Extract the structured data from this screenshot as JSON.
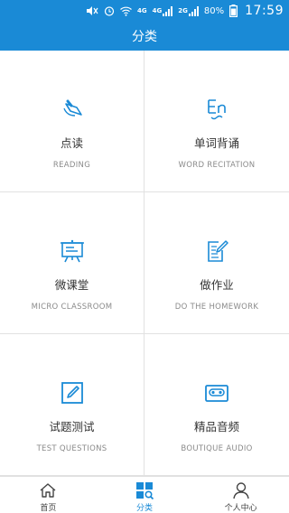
{
  "status_bar": {
    "network_a": "4G",
    "network_b": "4G",
    "network_c": "2G",
    "battery": "80%",
    "time": "17:59"
  },
  "title": "分类",
  "categories": [
    {
      "label": "点读",
      "sublabel": "READING",
      "icon": "reading-pen-icon"
    },
    {
      "label": "单词背诵",
      "sublabel": "WORD RECITATION",
      "icon": "en-word-icon"
    },
    {
      "label": "微课堂",
      "sublabel": "MICRO CLASSROOM",
      "icon": "presentation-board-icon"
    },
    {
      "label": "做作业",
      "sublabel": "DO THE HOMEWORK",
      "icon": "homework-edit-icon"
    },
    {
      "label": "试题测试",
      "sublabel": "TEST QUESTIONS",
      "icon": "pencil-square-icon"
    },
    {
      "label": "精品音频",
      "sublabel": "BOUTIQUE AUDIO",
      "icon": "cassette-icon"
    }
  ],
  "bottom_nav": [
    {
      "label": "首页",
      "icon": "home-icon",
      "active": false
    },
    {
      "label": "分类",
      "icon": "category-grid-icon",
      "active": true
    },
    {
      "label": "个人中心",
      "icon": "person-icon",
      "active": false
    }
  ],
  "colors": {
    "primary": "#1a8ad6",
    "divider": "#e1e1e1",
    "label": "#333333",
    "sublabel": "#8a8a8a"
  }
}
